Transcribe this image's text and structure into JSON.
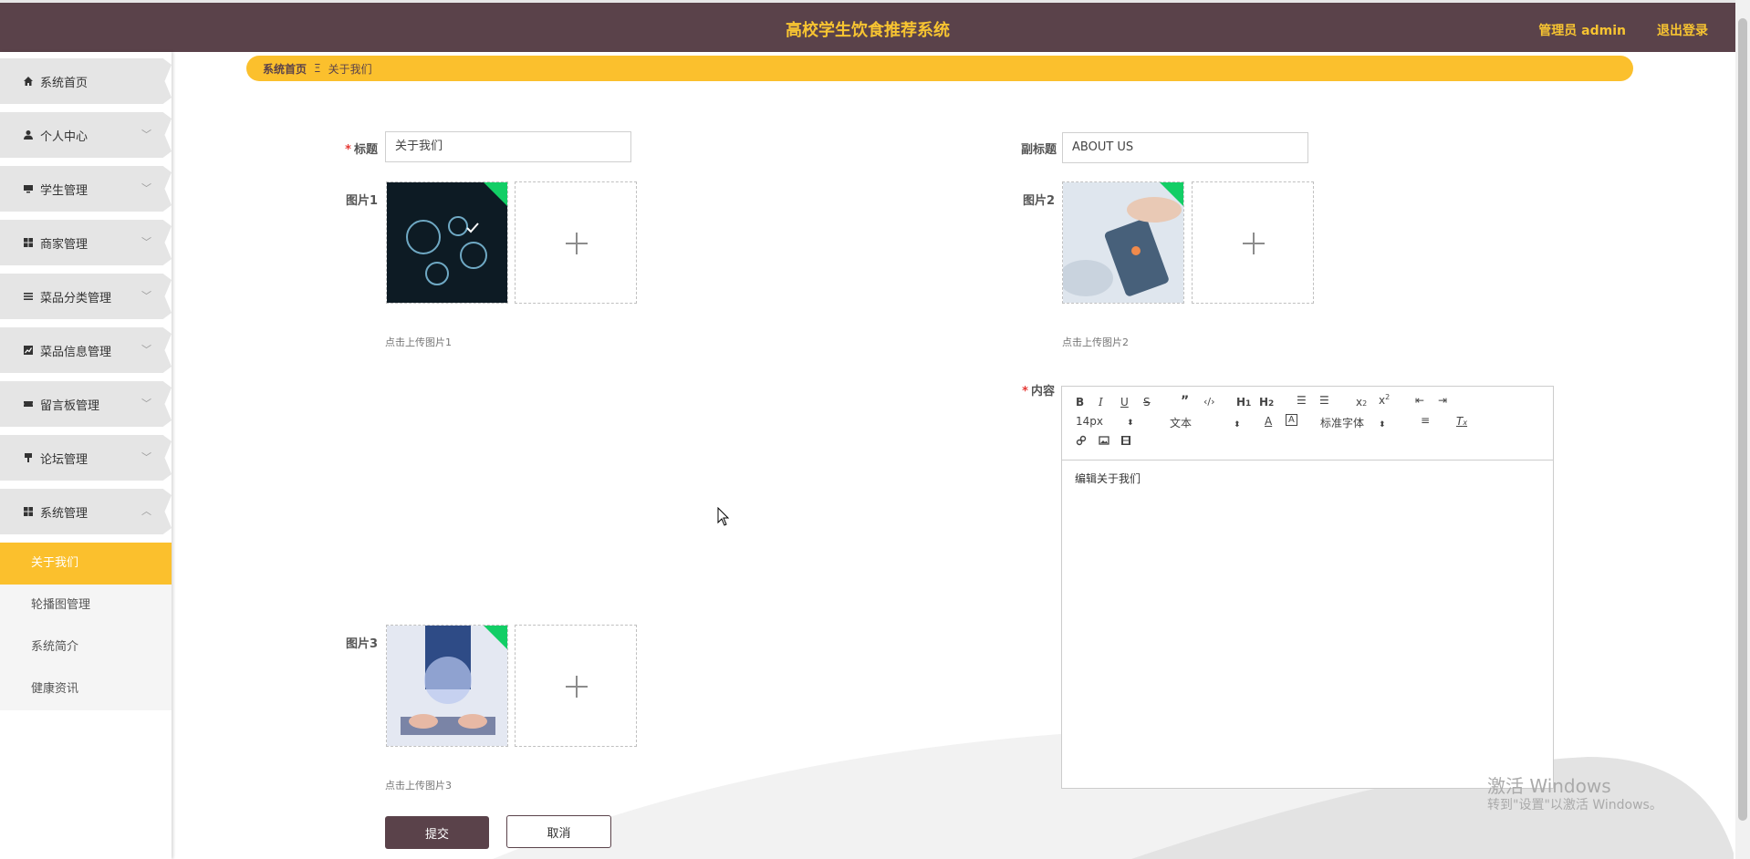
{
  "header": {
    "title": "高校学生饮食推荐系统",
    "admin_label": "管理员 admin",
    "logout_label": "退出登录",
    "bg_color": "#5a424a",
    "accent_color": "#f7c431"
  },
  "sidebar": {
    "items": [
      {
        "label": "系统首页",
        "icon": "home-icon"
      },
      {
        "label": "个人中心",
        "icon": "user-icon"
      },
      {
        "label": "学生管理",
        "icon": "monitor-icon"
      },
      {
        "label": "商家管理",
        "icon": "grid-icon"
      },
      {
        "label": "菜品分类管理",
        "icon": "list-icon"
      },
      {
        "label": "菜品信息管理",
        "icon": "chart-icon"
      },
      {
        "label": "留言板管理",
        "icon": "ticket-icon"
      },
      {
        "label": "论坛管理",
        "icon": "brush-icon"
      },
      {
        "label": "系统管理",
        "icon": "grid-icon"
      }
    ],
    "submenu": [
      {
        "label": "关于我们",
        "active": true
      },
      {
        "label": "轮播图管理"
      },
      {
        "label": "系统简介"
      },
      {
        "label": "健康资讯"
      }
    ]
  },
  "breadcrumb": {
    "home": "系统首页",
    "separator": "Ξ",
    "current": "关于我们"
  },
  "form": {
    "title_label": "标题",
    "title_value": "关于我们",
    "subtitle_label": "副标题",
    "subtitle_value": "ABOUT US",
    "image1_label": "图片1",
    "image1_hint": "点击上传图片1",
    "image2_label": "图片2",
    "image2_hint": "点击上传图片2",
    "image3_label": "图片3",
    "image3_hint": "点击上传图片3",
    "content_label": "内容",
    "submit_label": "提交",
    "cancel_label": "取消"
  },
  "editor": {
    "font_size": "14px",
    "block_type": "文本",
    "font_family": "标准字体",
    "content": "编辑关于我们"
  },
  "watermark": {
    "line1": "激活 Windows",
    "line2": "转到\"设置\"以激活 Windows。"
  }
}
